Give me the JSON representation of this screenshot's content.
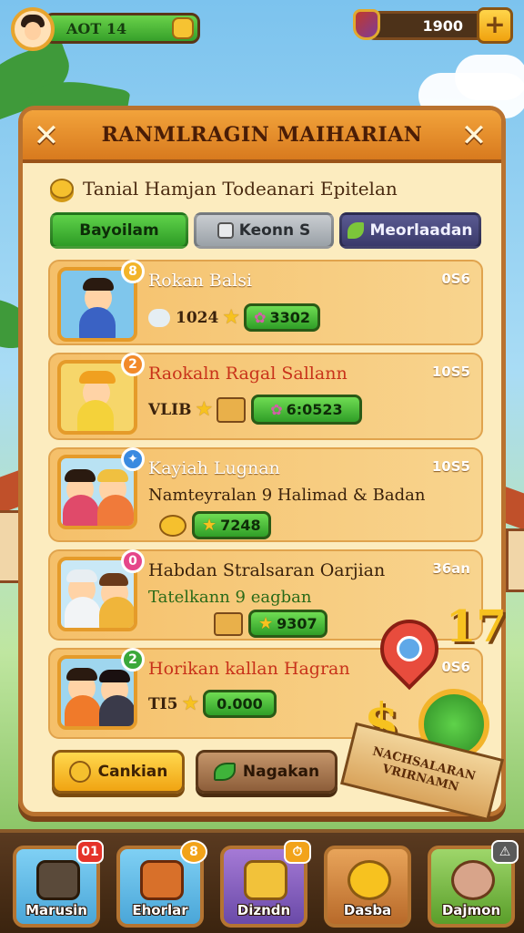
{
  "hud": {
    "level_text": "AOT 14",
    "currency_amount": "1900",
    "plus_label": "+"
  },
  "panel": {
    "title": "RANMLRAGIN MAIHARIAN",
    "close_left": "✕",
    "close_right": "✕",
    "subtitle": "Tanial Hamjan Todeanari Epitelan"
  },
  "tabs": [
    {
      "label": "Bayoilam"
    },
    {
      "label": "Keonn S"
    },
    {
      "label": "Meorlaadan"
    }
  ],
  "rows": [
    {
      "rank": "8",
      "name": "Rokan Balsi",
      "time": "0S6",
      "stat_label": "1024",
      "pill": "3302"
    },
    {
      "rank": "2",
      "name": "Raokaln Ragal Sallann",
      "time": "10S5",
      "stat_label": "VLIB",
      "pill": "6:0523"
    },
    {
      "rank": "✦",
      "name": "Kayiah Lugnan",
      "time": "10S5",
      "desc": "Namteyralan 9 Halimad & Badan",
      "pill": "7248"
    },
    {
      "rank": "0",
      "name": "Habdan Stralsaran Oarjian",
      "time": "36an",
      "desc": "Tatelkann 9 eagban",
      "pill": "9307"
    },
    {
      "rank": "2",
      "name": "Horikan kallan Hagran",
      "time": "0S6",
      "stat_label": "TI5",
      "pill": "0.000"
    }
  ],
  "buttons": {
    "left": "Cankian",
    "right": "Nagakan"
  },
  "decor": {
    "number": "17",
    "dollar": "$",
    "ribbon": "NACHSALARAN VRIRNAMN"
  },
  "nav": [
    {
      "label": "Marusin",
      "badge": "01"
    },
    {
      "label": "Ehorlar",
      "badge": "8"
    },
    {
      "label": "Dizndn",
      "badge": "⏱"
    },
    {
      "label": "Dasba",
      "badge": ""
    },
    {
      "label": "Dajmon",
      "badge": "⚠"
    }
  ],
  "colors": {
    "panel_bg": "#fcecbf",
    "header": "#f2a33b",
    "accent_green": "#36a02a",
    "gold": "#f7c21f"
  }
}
